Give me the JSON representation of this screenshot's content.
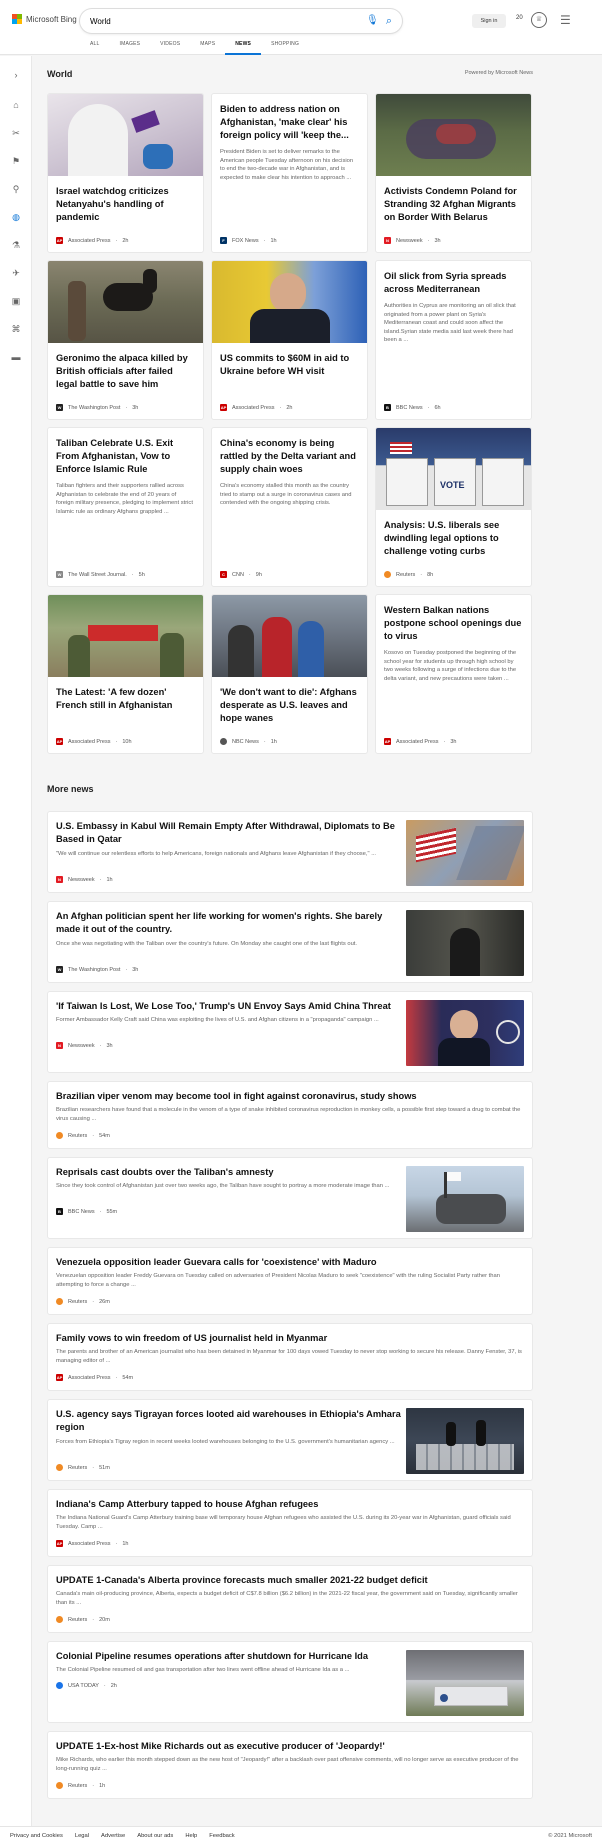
{
  "header": {
    "logo_text": "Microsoft Bing",
    "search_value": "World",
    "signin_label": "Sign in",
    "points": "20",
    "tabs": [
      {
        "label": "ALL"
      },
      {
        "label": "IMAGES"
      },
      {
        "label": "VIDEOS"
      },
      {
        "label": "MAPS"
      },
      {
        "label": "NEWS"
      },
      {
        "label": "SHOPPING"
      }
    ],
    "brand_colors": [
      "#f25022",
      "#7fba00",
      "#00a4ef",
      "#ffb900"
    ],
    "accent": "#0b74d6"
  },
  "sidebar": {
    "icons": [
      "chevron-right-icon",
      "home-icon",
      "sports-icon",
      "flag-icon",
      "location-pin-icon",
      "globe-icon",
      "science-icon",
      "tech-icon",
      "entertainment-icon",
      "business-icon",
      "politics-icon"
    ]
  },
  "world": {
    "title": "World",
    "powered_by": "Powered by Microsoft News",
    "cards": [
      {
        "title": "Israel watchdog criticizes Netanyahu's handling of pandemic",
        "summary": "",
        "source": "Associated Press",
        "time": "2h"
      },
      {
        "title": "Biden to address nation on Afghanistan, 'make clear' his foreign policy will 'keep the...",
        "summary": "President Biden is set to deliver remarks to the American people Tuesday afternoon on his decision to end the two-decade war in Afghanistan, and is expected to make clear his intention to approach ...",
        "source": "FOX News",
        "time": "1h"
      },
      {
        "title": "Activists Condemn Poland for Stranding 32 Afghan Migrants on Border With Belarus",
        "summary": "",
        "source": "Newsweek",
        "time": "3h"
      },
      {
        "title": "Geronimo the alpaca killed by British officials after failed legal battle to save him",
        "summary": "",
        "source": "The Washington Post",
        "time": "3h"
      },
      {
        "title": "US commits to $60M in aid to Ukraine before WH visit",
        "summary": "",
        "source": "Associated Press",
        "time": "2h"
      },
      {
        "title": "Oil slick from Syria spreads across Mediterranean",
        "summary": "Authorities in Cyprus are monitoring an oil slick that originated from a power plant on Syria's Mediterranean coast and could soon affect the island.Syrian state media said last week there had been a ...",
        "source": "BBC News",
        "time": "6h"
      },
      {
        "title": "Taliban Celebrate U.S. Exit From Afghanistan, Vow to Enforce Islamic Rule",
        "summary": "Taliban fighters and their supporters rallied across Afghanistan to celebrate the end of 20 years of foreign military presence, pledging to implement strict Islamic rule as ordinary Afghans grappled ...",
        "source": "The Wall Street Journal.",
        "time": "5h"
      },
      {
        "title": "China's economy is being rattled by the Delta variant and supply chain woes",
        "summary": "China's economy stalled this month as the country tried to stamp out a surge in coronavirus cases and contended with the ongoing shipping crisis.",
        "source": "CNN",
        "time": "9h"
      },
      {
        "title": "Analysis: U.S. liberals see dwindling legal options to challenge voting curbs",
        "summary": "",
        "source": "Reuters",
        "time": "8h"
      },
      {
        "title": "The Latest: 'A few dozen' French still in Afghanistan",
        "summary": "",
        "source": "Associated Press",
        "time": "10h"
      },
      {
        "title": "'We don't want to die': Afghans desperate as U.S. leaves and hope wanes",
        "summary": "",
        "source": "NBC News",
        "time": "1h"
      },
      {
        "title": "Western Balkan nations postpone school openings due to virus",
        "summary": "Kosovo on Tuesday postponed the beginning of the school year for students up through high school by two weeks following a surge of infections due to the delta variant, and new precautions were taken ...",
        "source": "Associated Press",
        "time": "3h"
      }
    ]
  },
  "more_news": {
    "title": "More news",
    "items": [
      {
        "title": "U.S. Embassy in Kabul Will Remain Empty After Withdrawal, Diplomats to Be Based in Qatar",
        "summary": "\"We will continue our relentless efforts to help Americans, foreign nationals and Afghans leave Afghanistan if they choose,\" ...",
        "source": "Newsweek",
        "time": "1h"
      },
      {
        "title": "An Afghan politician spent her life working for women's rights. She barely made it out of the country.",
        "summary": "Once she was negotiating with the Taliban over the country's future. On Monday she caught one of the last flights out.",
        "source": "The Washington Post",
        "time": "3h"
      },
      {
        "title": "'If Taiwan Is Lost, We Lose Too,' Trump's UN Envoy Says Amid China Threat",
        "summary": "Former Ambassador Kelly Craft said China was exploiting the lives of U.S. and Afghan citizens in a \"propaganda\" campaign ...",
        "source": "Newsweek",
        "time": "3h"
      },
      {
        "title": "Brazilian viper venom may become tool in fight against coronavirus, study shows",
        "summary": "Brazilian researchers have found that a molecule in the venom of a type of snake inhibited coronavirus reproduction in monkey cells, a possible first step toward a drug to combat the virus causing ...",
        "source": "Reuters",
        "time": "54m"
      },
      {
        "title": "Reprisals cast doubts over the Taliban's amnesty",
        "summary": "Since they took control of Afghanistan just over two weeks ago, the Taliban have sought to portray a more moderate image than ...",
        "source": "BBC News",
        "time": "55m"
      },
      {
        "title": "Venezuela opposition leader Guevara calls for 'coexistence' with Maduro",
        "summary": "Venezuelan opposition leader Freddy Guevara on Tuesday called on adversaries of President Nicolas Maduro to seek \"coexistence\" with the ruling Socialist Party rather than attempting to force a change ...",
        "source": "Reuters",
        "time": "26m"
      },
      {
        "title": "Family vows to win freedom of US journalist held in Myanmar",
        "summary": "The parents and brother of an American journalist who has been detained in Myanmar for 100 days vowed Tuesday to never stop working to secure his release. Danny Fenster, 37, is managing editor of ...",
        "source": "Associated Press",
        "time": "54m"
      },
      {
        "title": "U.S. agency says Tigrayan forces looted aid warehouses in Ethiopia's Amhara region",
        "summary": "Forces from Ethiopia's Tigray region in recent weeks looted warehouses belonging to the U.S. government's humanitarian agency ...",
        "source": "Reuters",
        "time": "51m"
      },
      {
        "title": "Indiana's Camp Atterbury tapped to house Afghan refugees",
        "summary": "The Indiana National Guard's Camp Atterbury training base will temporary house Afghan refugees who assisted the U.S. during its 20-year war in Afghanistan, guard officials said Tuesday. Camp ...",
        "source": "Associated Press",
        "time": "1h"
      },
      {
        "title": "UPDATE 1-Canada's Alberta province forecasts much smaller 2021-22 budget deficit",
        "summary": "Canada's main oil-producing province, Alberta, expects a budget deficit of C$7.8 billion ($6.2 billion) in the 2021-22 fiscal year, the government said on Tuesday, significantly smaller than its ...",
        "source": "Reuters",
        "time": "20m"
      },
      {
        "title": "Colonial Pipeline resumes operations after shutdown for Hurricane Ida",
        "summary": "The Colonial Pipeline resumed oil and gas transportation after two lines went offline ahead of Hurricane Ida as a ...",
        "source": "USA TODAY",
        "time": "2h"
      },
      {
        "title": "UPDATE 1-Ex-host Mike Richards out as executive producer of 'Jeopardy!'",
        "summary": "Mike Richards, who earlier this month stepped down as the new host of \"Jeopardy!\" after a backlash over past offensive comments, will no longer serve as executive producer of the long-running quiz ...",
        "source": "Reuters",
        "time": "1h"
      }
    ]
  },
  "footer": {
    "links": [
      "Privacy and Cookies",
      "Legal",
      "Advertise",
      "About our ads",
      "Help",
      "Feedback"
    ],
    "copyright": "© 2021 Microsoft"
  }
}
